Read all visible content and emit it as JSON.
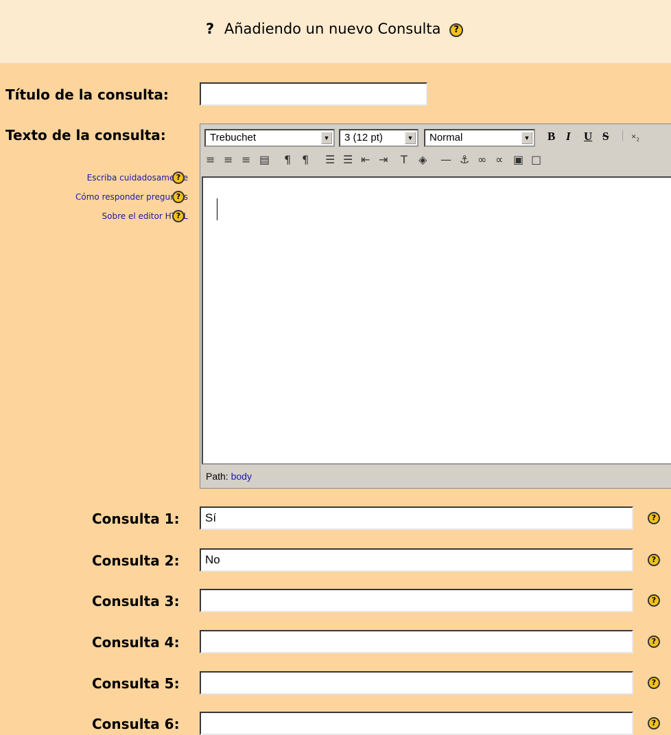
{
  "header": {
    "question_mark": "?",
    "title": "Añadiendo un nuevo Consulta",
    "help_glyph": "?"
  },
  "form": {
    "titulo_label": "Título de la consulta:",
    "titulo_value": "",
    "texto_label": "Texto de la consulta:",
    "help_links": [
      {
        "label": "Escriba cuidadosamente"
      },
      {
        "label": "Cómo responder preguntas"
      },
      {
        "label": "Sobre el editor HTML"
      }
    ]
  },
  "editor": {
    "font": "Trebuchet",
    "size": "3 (12 pt)",
    "format": "Normal",
    "bold": "B",
    "italic": "I",
    "underline": "U",
    "strike": "S",
    "subscript": "×₂",
    "path_label": "Path:",
    "path_value": "body"
  },
  "options": [
    {
      "label": "Consulta 1:",
      "value": "Sí"
    },
    {
      "label": "Consulta 2:",
      "value": "No"
    },
    {
      "label": "Consulta 3:",
      "value": ""
    },
    {
      "label": "Consulta 4:",
      "value": ""
    },
    {
      "label": "Consulta 5:",
      "value": ""
    },
    {
      "label": "Consulta 6:",
      "value": ""
    }
  ],
  "colors": {
    "background": "#fcd49c",
    "header": "#fdebd0",
    "link": "#1a1aa0",
    "help_icon": "#f3c21a"
  }
}
